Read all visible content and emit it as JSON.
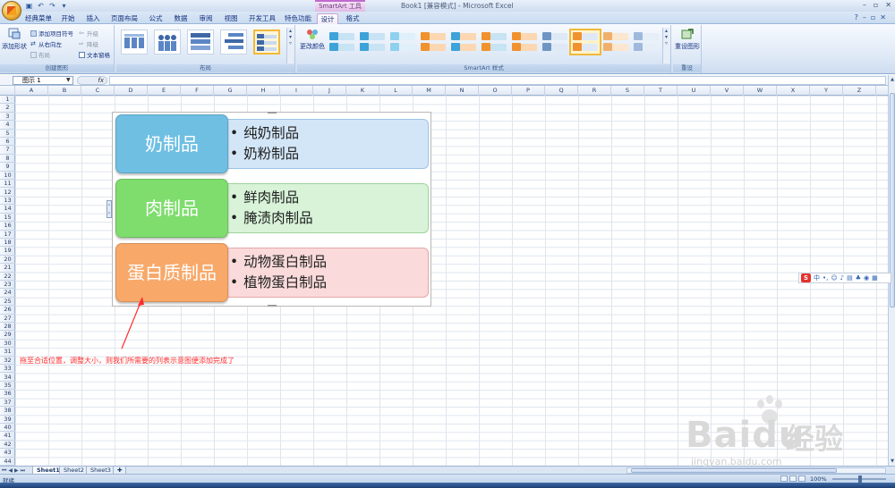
{
  "title_bar": {
    "context_group": "SmartArt 工具",
    "window_title": "Book1 [兼容模式] - Microsoft Excel",
    "window_controls": [
      "–",
      "▫",
      "✕"
    ]
  },
  "tabs": [
    {
      "label": "经典菜单",
      "active": false
    },
    {
      "label": "开始",
      "active": false
    },
    {
      "label": "插入",
      "active": false
    },
    {
      "label": "页面布局",
      "active": false
    },
    {
      "label": "公式",
      "active": false
    },
    {
      "label": "数据",
      "active": false
    },
    {
      "label": "审阅",
      "active": false
    },
    {
      "label": "视图",
      "active": false
    },
    {
      "label": "开发工具",
      "active": false
    },
    {
      "label": "特色功能",
      "active": false
    },
    {
      "label": "设计",
      "active": true
    },
    {
      "label": "格式",
      "active": false
    }
  ],
  "ribbon": {
    "create_graphic": {
      "label": "创建图形",
      "add_shape": "添加形状",
      "add_bullet": "添加项目符号",
      "right_to_left": "从右向左",
      "layout": "布局",
      "promote": "升级",
      "demote": "降级",
      "text_pane": "文本窗格"
    },
    "layouts": {
      "label": "布局"
    },
    "styles": {
      "label": "SmartArt 样式",
      "change_colors": "更改颜色"
    },
    "reset": {
      "label": "重设",
      "reset_graphic": "重设图形"
    }
  },
  "formula_bar": {
    "name_box": "图示 1",
    "fx": "fx",
    "formula": ""
  },
  "columns": [
    "A",
    "B",
    "C",
    "D",
    "E",
    "F",
    "G",
    "H",
    "I",
    "J",
    "K",
    "L",
    "M",
    "N",
    "O",
    "P",
    "Q",
    "R",
    "S",
    "T",
    "U",
    "V",
    "W",
    "X",
    "Y",
    "Z"
  ],
  "rows": [
    "1",
    "2",
    "3",
    "4",
    "5",
    "6",
    "7",
    "8",
    "9",
    "10",
    "11",
    "12",
    "13",
    "14",
    "15",
    "16",
    "17",
    "18",
    "19",
    "20",
    "21",
    "22",
    "23",
    "24",
    "25",
    "26",
    "27",
    "28",
    "29",
    "30",
    "31",
    "32",
    "33",
    "34",
    "35",
    "36",
    "37",
    "38",
    "39",
    "40",
    "41",
    "42",
    "43",
    "44"
  ],
  "smartart": {
    "items": [
      {
        "heading": "奶制品",
        "bullets": [
          "纯奶制品",
          "奶粉制品"
        ],
        "color": "#6fbfe3",
        "detail_bg": "#d3e6f7",
        "detail_border": "#9cc4e8"
      },
      {
        "heading": "肉制品",
        "bullets": [
          "鲜肉制品",
          "腌渍肉制品"
        ],
        "color": "#7fdd6e",
        "detail_bg": "#d8f3d8",
        "detail_border": "#9dd59a"
      },
      {
        "heading": "蛋白质制品",
        "bullets": [
          "动物蛋白制品",
          "植物蛋白制品"
        ],
        "color": "#f8a96a",
        "detail_bg": "#fadada",
        "detail_border": "#e4a7a7"
      }
    ]
  },
  "annotation": "拖至合适位置，调整大小，则我们所需要的列表示意图便添加完成了",
  "ime_toolbar": {
    "logo": "S",
    "mode": "中"
  },
  "watermark": {
    "brand": "Bai",
    "brand2": "du",
    "cn": "经验",
    "url": "jingyan.baidu.com"
  },
  "sheet_tabs": [
    {
      "label": "Sheet1",
      "active": true
    },
    {
      "label": "Sheet2",
      "active": false
    },
    {
      "label": "Sheet3",
      "active": false
    }
  ],
  "status": {
    "ready": "就绪",
    "zoom": "100%"
  }
}
